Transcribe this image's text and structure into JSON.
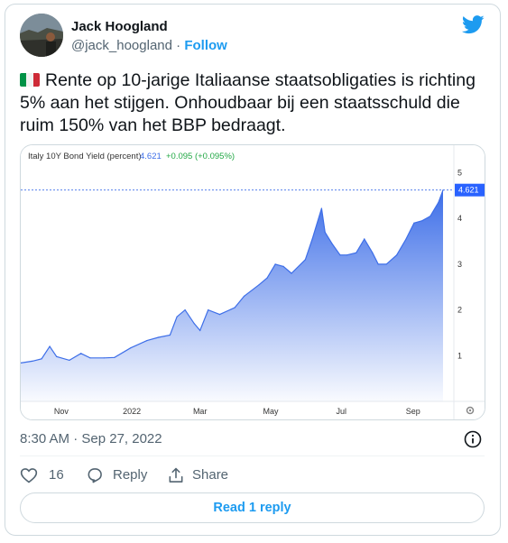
{
  "tweet": {
    "display_name": "Jack Hoogland",
    "handle": "@jack_hoogland",
    "separator": "·",
    "follow_label": "Follow",
    "text": "Rente op 10-jarige Italiaanse staatsobligaties is richting 5% aan het stijgen. Onhoudbaar bij een staatsschuld die ruim 150% van het BBP bedraagt.",
    "flag_icon": "italy-flag-icon",
    "timestamp": "8:30 AM · Sep 27, 2022",
    "likes": "16",
    "reply_label": "Reply",
    "share_label": "Share",
    "read_replies_label": "Read 1 reply",
    "brand_color": "#1d9bf0"
  },
  "chart_data": {
    "type": "area",
    "title": "Italy 10Y Bond Yield (percent)",
    "last_value": "4.621",
    "change": "+0.095 (+0.095%)",
    "last_value_badge": "4.621",
    "x_tick_labels": [
      "Nov",
      "2022",
      "Mar",
      "May",
      "Jul",
      "Sep"
    ],
    "y_tick_labels": [
      "1",
      "2",
      "3",
      "4",
      "5"
    ],
    "ylim": [
      0,
      5.6
    ],
    "fill_color": "#3d6ee8",
    "series": [
      {
        "x": [
          "2021-09-27",
          "2021-10-07",
          "2021-10-15",
          "2021-10-22",
          "2021-10-28",
          "2021-11-08",
          "2021-11-18",
          "2021-11-26",
          "2021-12-08",
          "2021-12-17",
          "2021-12-31",
          "2022-01-14",
          "2022-01-24",
          "2022-02-03",
          "2022-02-09",
          "2022-02-16",
          "2022-02-24",
          "2022-03-01",
          "2022-03-08",
          "2022-03-18",
          "2022-03-31",
          "2022-04-08",
          "2022-04-21",
          "2022-04-28",
          "2022-05-05",
          "2022-05-12",
          "2022-05-19",
          "2022-05-31",
          "2022-06-06",
          "2022-06-14",
          "2022-06-17",
          "2022-06-23",
          "2022-06-30",
          "2022-07-06",
          "2022-07-14",
          "2022-07-21",
          "2022-07-28",
          "2022-08-02",
          "2022-08-09",
          "2022-08-18",
          "2022-08-26",
          "2022-09-02",
          "2022-09-09",
          "2022-09-16",
          "2022-09-23",
          "2022-09-27"
        ],
        "y": [
          0.84,
          0.88,
          0.93,
          1.2,
          0.98,
          0.9,
          1.05,
          0.95,
          0.95,
          0.96,
          1.17,
          1.33,
          1.4,
          1.45,
          1.85,
          2.0,
          1.7,
          1.55,
          2.0,
          1.9,
          2.05,
          2.3,
          2.55,
          2.7,
          3.0,
          2.95,
          2.8,
          3.1,
          3.55,
          4.22,
          3.7,
          3.45,
          3.2,
          3.2,
          3.25,
          3.55,
          3.25,
          3.0,
          3.0,
          3.2,
          3.55,
          3.9,
          3.95,
          4.05,
          4.35,
          4.62
        ]
      }
    ]
  }
}
